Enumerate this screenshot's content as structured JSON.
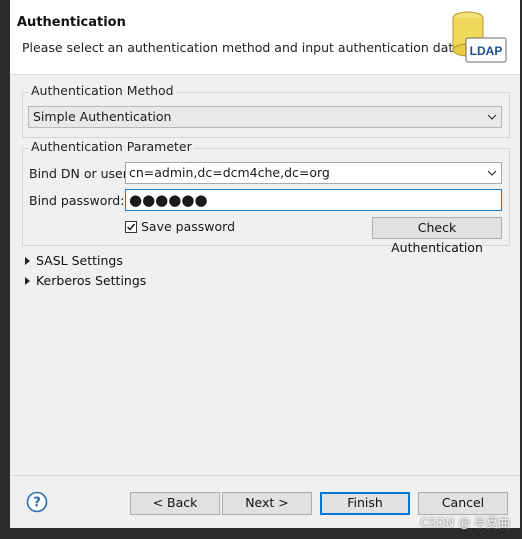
{
  "header": {
    "title": "Authentication",
    "description": "Please select an authentication method and input authentication data.",
    "badge_text": "LDAP"
  },
  "auth_method": {
    "legend": "Authentication Method",
    "selected": "Simple Authentication"
  },
  "auth_param": {
    "legend": "Authentication Parameter",
    "bind_dn_label": "Bind DN or user:",
    "bind_dn_value": "cn=admin,dc=dcm4che,dc=org",
    "bind_password_label": "Bind password:",
    "bind_password_masked": "●●●●●●",
    "save_password_label": "Save password",
    "save_password_checked": true,
    "check_button": "Check Authentication"
  },
  "sections": [
    {
      "label": "SASL Settings"
    },
    {
      "label": "Kerberos Settings"
    }
  ],
  "footer": {
    "back": "< Back",
    "next": "Next >",
    "finish": "Finish",
    "cancel": "Cancel"
  },
  "watermark": "CSDN @ 半夏曲",
  "colors": {
    "focus_border": "#1a7fd1",
    "default_button_border": "#0078d7",
    "help_icon": "#2b6cb0"
  }
}
